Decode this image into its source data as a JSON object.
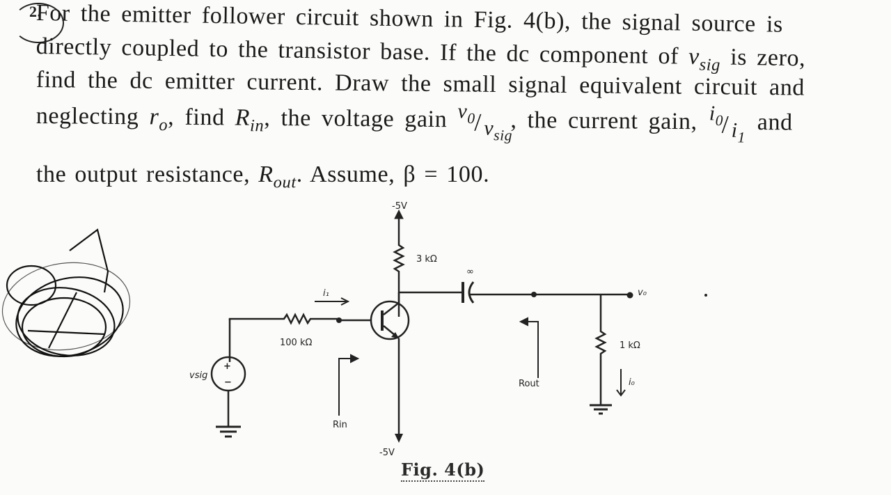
{
  "problem": {
    "number_label": "2.",
    "line1": "For the emitter follower circuit shown in Fig. 4(b), the signal source is",
    "line2_prefix": "directly coupled to the transistor base. If the dc component of",
    "line2_var": "v",
    "line2_var_sub": "sig",
    "line2_suffix": "is zero,",
    "line3": "find the dc emitter current. Draw the small signal equivalent circuit and",
    "line4_prefix": "neglecting",
    "line4_ro": "r",
    "line4_ro_sub": "o",
    "line4_mid1": ", find",
    "line4_rin": "R",
    "line4_rin_sub": "in",
    "line4_mid2": ", the voltage gain",
    "vgain_num": "v",
    "vgain_num_sub": "0",
    "vgain_slash": "/",
    "vgain_den": "v",
    "vgain_den_sub": "sig",
    "line4_mid3": ", the current gain,",
    "igain_num": "i",
    "igain_num_sub": "0",
    "igain_slash": "/",
    "igain_den": "i",
    "igain_den_sub": "1",
    "line4_end": "and",
    "line5_prefix": "the output resistance,",
    "line5_rout": "R",
    "line5_rout_sub": "out",
    "line5_suffix": ". Assume, β = 100."
  },
  "circuit": {
    "supply_top": "-5V",
    "supply_bottom": "-5V",
    "collector_resistor": "3 kΩ",
    "base_resistor": "100 kΩ",
    "load_resistor": "1 kΩ",
    "capacitor_value": "∞",
    "input_current": "i₁",
    "output_voltage": "v₀",
    "output_current": "i₀",
    "source_label": "vsig",
    "source_plus": "+",
    "source_minus": "−",
    "rin_label": "Rin",
    "rout_label": "Rout"
  },
  "figure": {
    "caption": "Fig. 4(b)"
  }
}
